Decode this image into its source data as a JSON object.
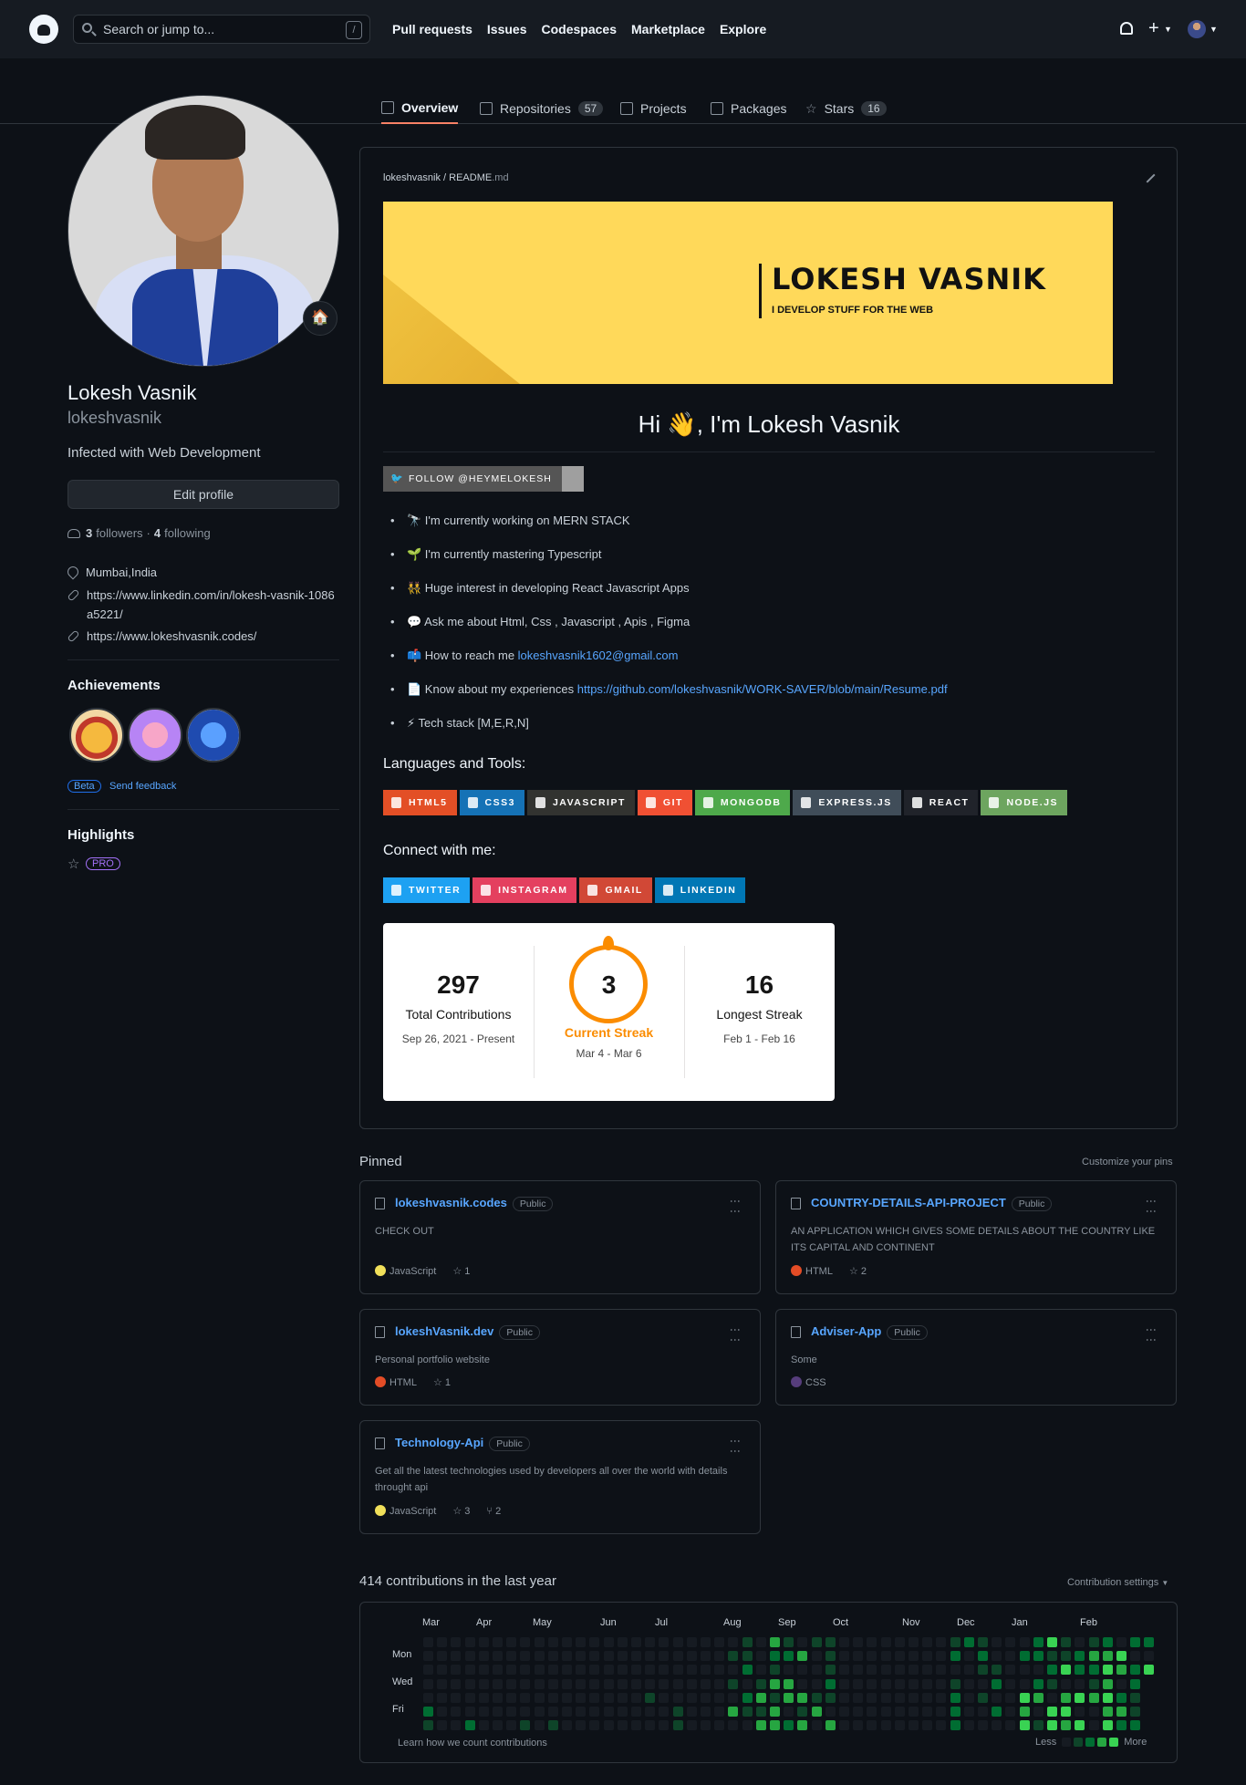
{
  "header": {
    "search_placeholder": "Search or jump to...",
    "search_shortcut": "/",
    "nav": [
      "Pull requests",
      "Issues",
      "Codespaces",
      "Marketplace",
      "Explore"
    ]
  },
  "tabs": [
    {
      "label": "Overview",
      "count": ""
    },
    {
      "label": "Repositories",
      "count": "57"
    },
    {
      "label": "Projects",
      "count": ""
    },
    {
      "label": "Packages",
      "count": ""
    },
    {
      "label": "Stars",
      "count": "16"
    }
  ],
  "profile": {
    "name": "Lokesh Vasnik",
    "login": "lokeshvasnik",
    "bio": "Infected with Web Development",
    "edit_label": "Edit profile",
    "followers_count": "3",
    "followers_label": "followers",
    "following_count": "4",
    "following_label": "following",
    "location": "Mumbai,India",
    "link1": "https://www.linkedin.com/in/lokesh-vasnik-1086a5221/",
    "link2": "https://www.lokeshvasnik.codes/",
    "status_emoji": "🏠",
    "achievements_title": "Achievements",
    "beta_label": "Beta",
    "feedback_label": "Send feedback",
    "highlights_title": "Highlights",
    "pro_label": "PRO"
  },
  "readme": {
    "path_user": "lokeshvasnik",
    "path_sep": " / ",
    "path_file": "README",
    "path_ext": ".md",
    "banner_title": "LOKESH VASNIK",
    "banner_sub": "I DEVELOP STUFF FOR THE WEB",
    "greeting": "Hi 👋, I'm Lokesh Vasnik",
    "follow_badge": "FOLLOW @HEYMELOKESH",
    "bullets": [
      {
        "text": "🔭 I'm currently working on MERN STACK",
        "link": ""
      },
      {
        "text": "🌱 I'm currently mastering Typescript",
        "link": ""
      },
      {
        "text": "👯 Huge interest in developing React Javascript Apps",
        "link": ""
      },
      {
        "text": "💬 Ask me about Html, Css , Javascript , Apis , Figma",
        "link": ""
      },
      {
        "text": "📫 How to reach me ",
        "link": "lokeshvasnik1602@gmail.com"
      },
      {
        "text": "📄 Know about my experiences ",
        "link": "https://github.com/lokeshvasnik/WORK-SAVER/blob/main/Resume.pdf"
      },
      {
        "text": "⚡ Tech stack [M,E,R,N]",
        "link": ""
      }
    ],
    "languages_title": "Languages and Tools:",
    "tools": [
      {
        "label": "HTML5",
        "color": "#e34f26"
      },
      {
        "label": "CSS3",
        "color": "#1572b6"
      },
      {
        "label": "JAVASCRIPT",
        "color": "#323330"
      },
      {
        "label": "GIT",
        "color": "#f05033"
      },
      {
        "label": "MONGODB",
        "color": "#4ea94b"
      },
      {
        "label": "EXPRESS.JS",
        "color": "#404d59"
      },
      {
        "label": "REACT",
        "color": "#20232a"
      },
      {
        "label": "NODE.JS",
        "color": "#6da55f"
      }
    ],
    "connect_title": "Connect with me:",
    "socials": [
      {
        "label": "TWITTER",
        "color": "#1da1f2"
      },
      {
        "label": "INSTAGRAM",
        "color": "#e4405f"
      },
      {
        "label": "GMAIL",
        "color": "#d14836"
      },
      {
        "label": "LINKEDIN",
        "color": "#0077b5"
      }
    ],
    "streak": {
      "total": "297",
      "total_label": "Total Contributions",
      "total_range": "Sep 26, 2021 - Present",
      "current": "3",
      "current_label": "Current Streak",
      "current_range": "Mar 4 - Mar 6",
      "longest": "16",
      "longest_label": "Longest Streak",
      "longest_range": "Feb 1 - Feb 16"
    }
  },
  "pinned": {
    "title": "Pinned",
    "customize": "Customize your pins",
    "public_label": "Public",
    "cards": [
      {
        "name": "lokeshvasnik.codes",
        "desc": "CHECK OUT",
        "lang": "JavaScript",
        "lang_color": "#f1e05a",
        "stars": "1",
        "forks": ""
      },
      {
        "name": "COUNTRY-DETAILS-API-PROJECT",
        "desc": "AN APPLICATION WHICH GIVES SOME DETAILS ABOUT THE COUNTRY LIKE ITS CAPITAL AND CONTINENT",
        "lang": "HTML",
        "lang_color": "#e34c26",
        "stars": "2",
        "forks": ""
      },
      {
        "name": "lokeshVasnik.dev",
        "desc": "Personal portfolio website",
        "lang": "HTML",
        "lang_color": "#e34c26",
        "stars": "1",
        "forks": ""
      },
      {
        "name": "Adviser-App",
        "desc": "Some",
        "lang": "CSS",
        "lang_color": "#563d7c",
        "stars": "",
        "forks": ""
      },
      {
        "name": "Technology-Api",
        "desc": "Get all the latest technologies used by developers all over the world with details throught api",
        "lang": "JavaScript",
        "lang_color": "#f1e05a",
        "stars": "3",
        "forks": "2"
      }
    ]
  },
  "contributions": {
    "title": "414 contributions in the last year",
    "settings": "Contribution settings",
    "months": [
      "Mar",
      "Apr",
      "May",
      "Jun",
      "Jul",
      "Aug",
      "Sep",
      "Oct",
      "Nov",
      "Dec",
      "Jan",
      "Feb"
    ],
    "days": [
      "Mon",
      "Wed",
      "Fri"
    ],
    "learn": "Learn how we count contributions",
    "less": "Less",
    "more": "More",
    "levels": [
      "#161b22",
      "#0e4429",
      "#006d32",
      "#26a641",
      "#39d353"
    ]
  }
}
